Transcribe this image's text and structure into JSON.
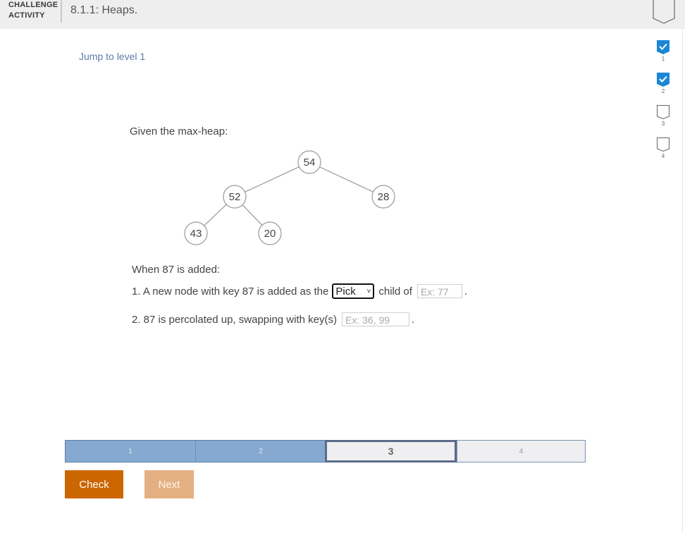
{
  "header": {
    "label_line1": "CHALLENGE",
    "label_line2": "ACTIVITY",
    "title": "8.1.1: Heaps.",
    "badge_icon": "level-badge-icon"
  },
  "jump_link": "Jump to level 1",
  "levels": [
    {
      "num": "1",
      "completed": true
    },
    {
      "num": "2",
      "completed": true
    },
    {
      "num": "3",
      "completed": false
    },
    {
      "num": "4",
      "completed": false
    }
  ],
  "colors": {
    "accent_blue": "#1a87d6",
    "check_orange": "#cc6600",
    "next_orange_disabled": "#e4b082",
    "progress_done": "#85a9d1"
  },
  "question": {
    "given_label": "Given the max-heap:",
    "heap": {
      "nodes": [
        {
          "key": "54"
        },
        {
          "key": "52"
        },
        {
          "key": "28"
        },
        {
          "key": "43"
        },
        {
          "key": "20"
        }
      ],
      "edges": [
        [
          "54",
          "52"
        ],
        [
          "54",
          "28"
        ],
        [
          "52",
          "43"
        ],
        [
          "52",
          "20"
        ]
      ]
    },
    "intro": "When 87 is added:",
    "step1_prefix": "1. A new node with key 87 is added as the",
    "step1_select_value": "Pick",
    "step1_middle": "child of",
    "step1_input_placeholder": "Ex: 77",
    "step1_suffix": ".",
    "step2_prefix": "2. 87 is percolated up, swapping with key(s)",
    "step2_input_placeholder": "Ex: 36, 99",
    "step2_suffix": "."
  },
  "progress": {
    "segments": [
      {
        "label": "1",
        "state": "done"
      },
      {
        "label": "2",
        "state": "done"
      },
      {
        "label": "3",
        "state": "current"
      },
      {
        "label": "4",
        "state": "todo"
      }
    ]
  },
  "buttons": {
    "check": "Check",
    "next": "Next"
  }
}
